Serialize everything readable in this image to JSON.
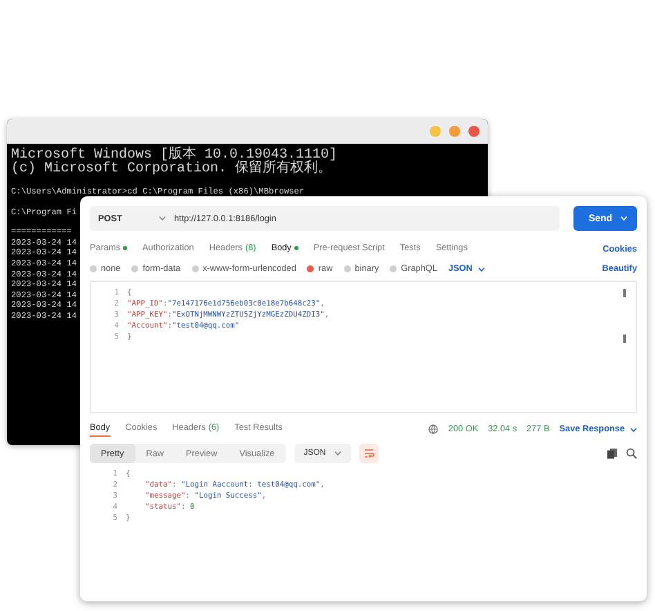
{
  "terminal": {
    "dots": [
      {
        "color": "#f4c343"
      },
      {
        "color": "#f29a3c"
      },
      {
        "color": "#e9544b"
      }
    ],
    "lines": [
      {
        "kind": "cjk",
        "text": "Microsoft Windows [版本 10.0.19043.1110]"
      },
      {
        "kind": "cjk",
        "text": "(c) Microsoft Corporation. 保留所有权利。"
      },
      {
        "kind": "blank"
      },
      {
        "kind": "text",
        "text": "C:\\Users\\Administrator>cd C:\\Program Files (x86)\\MBbrowser"
      },
      {
        "kind": "blank"
      },
      {
        "kind": "text",
        "text": "C:\\Program Fi"
      },
      {
        "kind": "blank"
      },
      {
        "kind": "text",
        "text": "============"
      },
      {
        "kind": "text",
        "text": "2023-03-24 14"
      },
      {
        "kind": "text",
        "text": "2023-03-24 14"
      },
      {
        "kind": "text",
        "text": "2023-03-24 14"
      },
      {
        "kind": "text",
        "text": "2023-03-24 14"
      },
      {
        "kind": "text",
        "text": "2023-03-24 14"
      },
      {
        "kind": "text",
        "text": "2023-03-24 14"
      },
      {
        "kind": "text",
        "text": "2023-03-24 14"
      },
      {
        "kind": "text",
        "text": "2023-03-24 14"
      }
    ]
  },
  "request": {
    "method": "POST",
    "url": "http://127.0.0.1:8186/login",
    "send": "Send",
    "tabs": [
      {
        "label": "Params",
        "dot": true,
        "selected": false
      },
      {
        "label": "Authorization",
        "dot": false,
        "selected": false
      },
      {
        "label": "Headers",
        "count": "(8)",
        "dot": false,
        "selected": false
      },
      {
        "label": "Body",
        "dot": true,
        "selected": true
      },
      {
        "label": "Pre-request Script",
        "dot": false,
        "selected": false
      },
      {
        "label": "Tests",
        "dot": false,
        "selected": false
      },
      {
        "label": "Settings",
        "dot": false,
        "selected": false
      }
    ],
    "cookies": "Cookies",
    "body_types": [
      {
        "label": "none",
        "selected": false
      },
      {
        "label": "form-data",
        "selected": false
      },
      {
        "label": "x-www-form-urlencoded",
        "selected": false
      },
      {
        "label": "raw",
        "selected": true
      },
      {
        "label": "binary",
        "selected": false
      },
      {
        "label": "GraphQL",
        "selected": false
      }
    ],
    "format": "JSON",
    "beautify": "Beautify",
    "lines": [
      {
        "number": "1",
        "tokens": [
          {
            "kind": "punct",
            "text": "{"
          }
        ]
      },
      {
        "number": "2",
        "tokens": [
          {
            "kind": "key",
            "text": "\"APP_ID\""
          },
          {
            "kind": "punct",
            "text": ":"
          },
          {
            "kind": "string",
            "text": "\"7e147176e1d756eb03c0e18e7b648c23\""
          },
          {
            "kind": "punct",
            "text": ","
          }
        ]
      },
      {
        "number": "3",
        "tokens": [
          {
            "kind": "key",
            "text": "\"APP_KEY\""
          },
          {
            "kind": "punct",
            "text": ":"
          },
          {
            "kind": "string",
            "text": "\"ExOTNjMWNWYzZTU5ZjYzMGEzZDU4ZDI3\""
          },
          {
            "kind": "punct",
            "text": ","
          }
        ]
      },
      {
        "number": "4",
        "tokens": [
          {
            "kind": "key",
            "text": "\"Account\""
          },
          {
            "kind": "punct",
            "text": ":"
          },
          {
            "kind": "string",
            "text": "\"test04@qq.com\""
          }
        ]
      },
      {
        "number": "5",
        "tokens": [
          {
            "kind": "punct",
            "text": "}"
          }
        ]
      }
    ]
  },
  "response": {
    "tabs": [
      {
        "label": "Body",
        "selected": true
      },
      {
        "label": "Cookies",
        "selected": false
      },
      {
        "label": "Headers",
        "count": "(6)",
        "selected": false
      },
      {
        "label": "Test Results",
        "selected": false
      }
    ],
    "status": "200 OK",
    "time": "32.04 s",
    "size": "277 B",
    "save": "Save Response",
    "views": [
      {
        "label": "Pretty",
        "selected": true
      },
      {
        "label": "Raw",
        "selected": false
      },
      {
        "label": "Preview",
        "selected": false
      },
      {
        "label": "Visualize",
        "selected": false
      }
    ],
    "format": "JSON",
    "lines": [
      {
        "number": "1",
        "tokens": [
          {
            "kind": "punct",
            "text": "{"
          }
        ]
      },
      {
        "number": "2",
        "indent": true,
        "tokens": [
          {
            "kind": "key",
            "text": "\"data\""
          },
          {
            "kind": "punct",
            "text": ": "
          },
          {
            "kind": "string",
            "text": "\"Login Aaccount: test04@qq.com\""
          },
          {
            "kind": "punct",
            "text": ","
          }
        ]
      },
      {
        "number": "3",
        "indent": true,
        "tokens": [
          {
            "kind": "key",
            "text": "\"message\""
          },
          {
            "kind": "punct",
            "text": ": "
          },
          {
            "kind": "string",
            "text": "\"Login Success\""
          },
          {
            "kind": "punct",
            "text": ","
          }
        ]
      },
      {
        "number": "4",
        "indent": true,
        "tokens": [
          {
            "kind": "key",
            "text": "\"status\""
          },
          {
            "kind": "punct",
            "text": ": "
          },
          {
            "kind": "number",
            "text": "0"
          }
        ]
      },
      {
        "number": "5",
        "tokens": [
          {
            "kind": "punct",
            "text": "}"
          }
        ]
      }
    ]
  }
}
